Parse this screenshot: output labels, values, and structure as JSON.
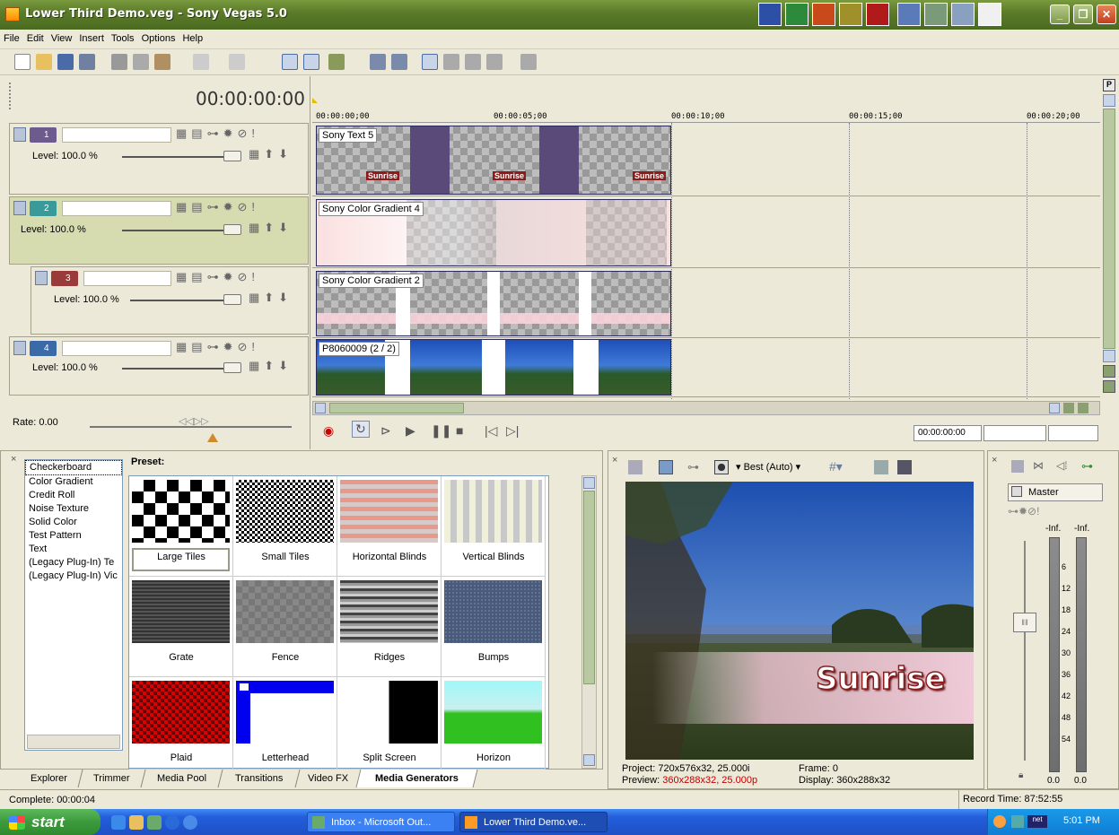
{
  "window": {
    "title": "Lower Third Demo.veg - Sony Vegas 5.0",
    "icon": "vegas-icon",
    "controls": [
      "minimize",
      "restore",
      "close"
    ]
  },
  "menu": [
    "File",
    "Edit",
    "View",
    "Insert",
    "Tools",
    "Options",
    "Help"
  ],
  "timeline": {
    "cursor_time": "00:00:00:00",
    "ruler_ticks": [
      "00:00:00;00",
      "00:00:05;00",
      "00:00:10;00",
      "00:00:15;00",
      "00:00:20;00"
    ],
    "end_time": "00:00:00:00"
  },
  "tracks": [
    {
      "number": "1",
      "level": "Level: 100.0 %",
      "clip": "Sony Text 5",
      "color": "#6d5b8d"
    },
    {
      "number": "2",
      "level": "Level: 100.0 %",
      "clip": "Sony Color Gradient 4",
      "color": "#3a9a9a"
    },
    {
      "number": "3",
      "level": "Level: 100.0 %",
      "clip": "Sony Color Gradient 2",
      "color": "#9a3a3a"
    },
    {
      "number": "4",
      "level": "Level: 100.0 %",
      "clip": "P8060009  (2 / 2)",
      "color": "#3a6aa8"
    }
  ],
  "sunrise_label": "Sunrise",
  "rate": "Rate: 0.00",
  "media_generators": {
    "preset_label": "Preset:",
    "generators": [
      "Checkerboard",
      "Color Gradient",
      "Credit Roll",
      "Noise Texture",
      "Solid Color",
      "Test Pattern",
      "Text",
      "(Legacy Plug-In) Te",
      "(Legacy Plug-In) Vic"
    ],
    "presets": [
      "Large Tiles",
      "Small Tiles",
      "Horizontal Blinds",
      "Vertical Blinds",
      "Grate",
      "Fence",
      "Ridges",
      "Bumps",
      "Plaid",
      "Letterhead",
      "Split Screen",
      "Horizon"
    ]
  },
  "tabs": [
    "Explorer",
    "Trimmer",
    "Media Pool",
    "Transitions",
    "Video FX",
    "Media Generators"
  ],
  "active_tab": "Media Generators",
  "preview": {
    "quality": "Best (Auto)",
    "overlay_text": "Sunrise",
    "project_label": "Project:",
    "project_value": "720x576x32, 25.000i",
    "preview_label": "Preview:",
    "preview_value": "360x288x32, 25.000p",
    "frame_label": "Frame:",
    "frame_value": "0",
    "display_label": "Display:",
    "display_value": "360x288x32"
  },
  "mixer": {
    "master": "Master",
    "left_peak": "-Inf.",
    "right_peak": "-Inf.",
    "scale": [
      "6",
      "12",
      "18",
      "24",
      "30",
      "36",
      "42",
      "48",
      "54"
    ],
    "left_value": "0.0",
    "right_value": "0.0"
  },
  "status": {
    "left": "Complete: 00:00:04",
    "right": "Record Time: 87:52:55"
  },
  "taskbar": {
    "start": "start",
    "items": [
      "Inbox - Microsoft Out...",
      "Lower Third Demo.ve..."
    ],
    "clock": "5:01 PM"
  }
}
